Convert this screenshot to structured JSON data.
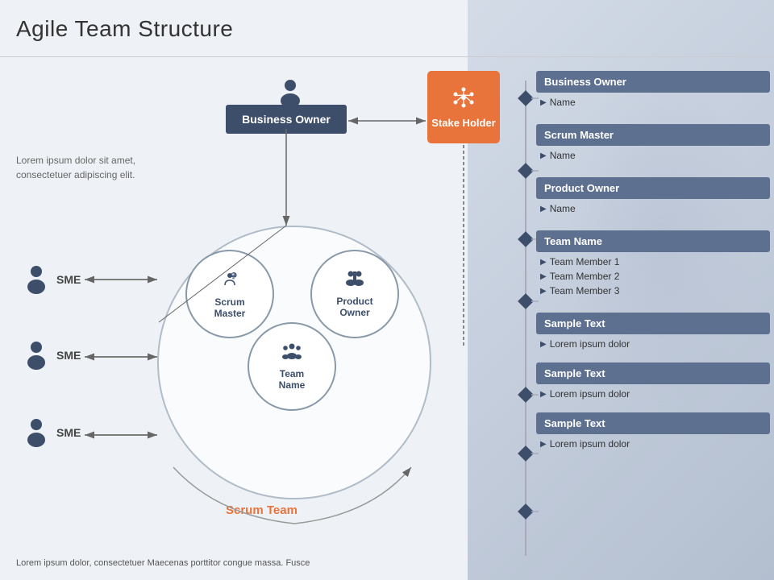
{
  "title": "Agile Team Structure",
  "left_text": "Lorem ipsum dolor sit amet, consectetuer adipiscing elit.",
  "bottom_text": "Lorem ipsum dolor, consectetuer Maecenas  porttitor congue massa. Fusce",
  "business_owner": {
    "label": "Business Owner"
  },
  "stakeholder": {
    "label": "Stake Holder",
    "icon": "⬡"
  },
  "scrum_team_label": "Scrum Team",
  "circles": {
    "scrum_master": {
      "label": "Scrum\nMaster",
      "icon": "⚙"
    },
    "product_owner": {
      "label": "Product\nOwner",
      "icon": "👥"
    },
    "team_name": {
      "label": "Team\nName",
      "icon": "👥"
    }
  },
  "sme_items": [
    {
      "label": "SME"
    },
    {
      "label": "SME"
    },
    {
      "label": "SME"
    }
  ],
  "right_panel": {
    "items": [
      {
        "header": "Business Owner",
        "subs": [
          "Name"
        ]
      },
      {
        "header": "Scrum Master",
        "subs": [
          "Name"
        ]
      },
      {
        "header": "Product Owner",
        "subs": [
          "Name"
        ]
      },
      {
        "header": "Team Name",
        "subs": [
          "Team Member 1",
          "Team Member 2",
          "Team Member 3"
        ]
      },
      {
        "header": "Sample Text",
        "subs": [
          "Lorem ipsum dolor"
        ]
      },
      {
        "header": "Sample Text",
        "subs": [
          "Lorem ipsum dolor"
        ]
      },
      {
        "header": "Sample Text",
        "subs": [
          "Lorem ipsum dolor"
        ]
      }
    ]
  }
}
